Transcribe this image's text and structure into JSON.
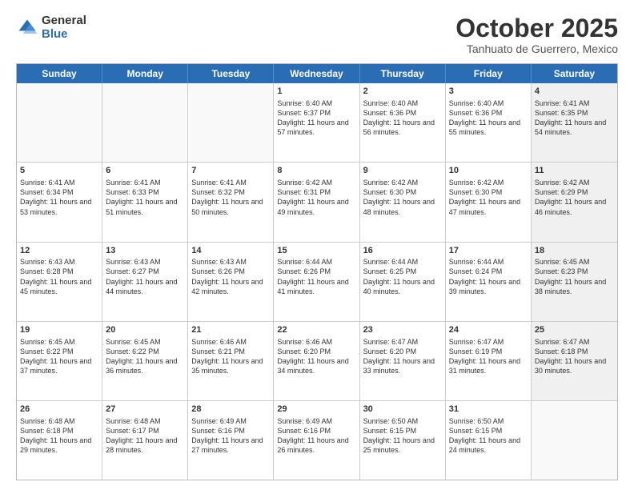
{
  "logo": {
    "general": "General",
    "blue": "Blue"
  },
  "title": "October 2025",
  "location": "Tanhuato de Guerrero, Mexico",
  "header_days": [
    "Sunday",
    "Monday",
    "Tuesday",
    "Wednesday",
    "Thursday",
    "Friday",
    "Saturday"
  ],
  "rows": [
    [
      {
        "day": "",
        "text": "",
        "empty": true
      },
      {
        "day": "",
        "text": "",
        "empty": true
      },
      {
        "day": "",
        "text": "",
        "empty": true
      },
      {
        "day": "1",
        "text": "Sunrise: 6:40 AM\nSunset: 6:37 PM\nDaylight: 11 hours and 57 minutes."
      },
      {
        "day": "2",
        "text": "Sunrise: 6:40 AM\nSunset: 6:36 PM\nDaylight: 11 hours and 56 minutes."
      },
      {
        "day": "3",
        "text": "Sunrise: 6:40 AM\nSunset: 6:36 PM\nDaylight: 11 hours and 55 minutes."
      },
      {
        "day": "4",
        "text": "Sunrise: 6:41 AM\nSunset: 6:35 PM\nDaylight: 11 hours and 54 minutes.",
        "shaded": true
      }
    ],
    [
      {
        "day": "5",
        "text": "Sunrise: 6:41 AM\nSunset: 6:34 PM\nDaylight: 11 hours and 53 minutes."
      },
      {
        "day": "6",
        "text": "Sunrise: 6:41 AM\nSunset: 6:33 PM\nDaylight: 11 hours and 51 minutes."
      },
      {
        "day": "7",
        "text": "Sunrise: 6:41 AM\nSunset: 6:32 PM\nDaylight: 11 hours and 50 minutes."
      },
      {
        "day": "8",
        "text": "Sunrise: 6:42 AM\nSunset: 6:31 PM\nDaylight: 11 hours and 49 minutes."
      },
      {
        "day": "9",
        "text": "Sunrise: 6:42 AM\nSunset: 6:30 PM\nDaylight: 11 hours and 48 minutes."
      },
      {
        "day": "10",
        "text": "Sunrise: 6:42 AM\nSunset: 6:30 PM\nDaylight: 11 hours and 47 minutes."
      },
      {
        "day": "11",
        "text": "Sunrise: 6:42 AM\nSunset: 6:29 PM\nDaylight: 11 hours and 46 minutes.",
        "shaded": true
      }
    ],
    [
      {
        "day": "12",
        "text": "Sunrise: 6:43 AM\nSunset: 6:28 PM\nDaylight: 11 hours and 45 minutes."
      },
      {
        "day": "13",
        "text": "Sunrise: 6:43 AM\nSunset: 6:27 PM\nDaylight: 11 hours and 44 minutes."
      },
      {
        "day": "14",
        "text": "Sunrise: 6:43 AM\nSunset: 6:26 PM\nDaylight: 11 hours and 42 minutes."
      },
      {
        "day": "15",
        "text": "Sunrise: 6:44 AM\nSunset: 6:26 PM\nDaylight: 11 hours and 41 minutes."
      },
      {
        "day": "16",
        "text": "Sunrise: 6:44 AM\nSunset: 6:25 PM\nDaylight: 11 hours and 40 minutes."
      },
      {
        "day": "17",
        "text": "Sunrise: 6:44 AM\nSunset: 6:24 PM\nDaylight: 11 hours and 39 minutes."
      },
      {
        "day": "18",
        "text": "Sunrise: 6:45 AM\nSunset: 6:23 PM\nDaylight: 11 hours and 38 minutes.",
        "shaded": true
      }
    ],
    [
      {
        "day": "19",
        "text": "Sunrise: 6:45 AM\nSunset: 6:22 PM\nDaylight: 11 hours and 37 minutes."
      },
      {
        "day": "20",
        "text": "Sunrise: 6:45 AM\nSunset: 6:22 PM\nDaylight: 11 hours and 36 minutes."
      },
      {
        "day": "21",
        "text": "Sunrise: 6:46 AM\nSunset: 6:21 PM\nDaylight: 11 hours and 35 minutes."
      },
      {
        "day": "22",
        "text": "Sunrise: 6:46 AM\nSunset: 6:20 PM\nDaylight: 11 hours and 34 minutes."
      },
      {
        "day": "23",
        "text": "Sunrise: 6:47 AM\nSunset: 6:20 PM\nDaylight: 11 hours and 33 minutes."
      },
      {
        "day": "24",
        "text": "Sunrise: 6:47 AM\nSunset: 6:19 PM\nDaylight: 11 hours and 31 minutes."
      },
      {
        "day": "25",
        "text": "Sunrise: 6:47 AM\nSunset: 6:18 PM\nDaylight: 11 hours and 30 minutes.",
        "shaded": true
      }
    ],
    [
      {
        "day": "26",
        "text": "Sunrise: 6:48 AM\nSunset: 6:18 PM\nDaylight: 11 hours and 29 minutes."
      },
      {
        "day": "27",
        "text": "Sunrise: 6:48 AM\nSunset: 6:17 PM\nDaylight: 11 hours and 28 minutes."
      },
      {
        "day": "28",
        "text": "Sunrise: 6:49 AM\nSunset: 6:16 PM\nDaylight: 11 hours and 27 minutes."
      },
      {
        "day": "29",
        "text": "Sunrise: 6:49 AM\nSunset: 6:16 PM\nDaylight: 11 hours and 26 minutes."
      },
      {
        "day": "30",
        "text": "Sunrise: 6:50 AM\nSunset: 6:15 PM\nDaylight: 11 hours and 25 minutes."
      },
      {
        "day": "31",
        "text": "Sunrise: 6:50 AM\nSunset: 6:15 PM\nDaylight: 11 hours and 24 minutes."
      },
      {
        "day": "",
        "text": "",
        "empty": true,
        "shaded": true
      }
    ]
  ]
}
